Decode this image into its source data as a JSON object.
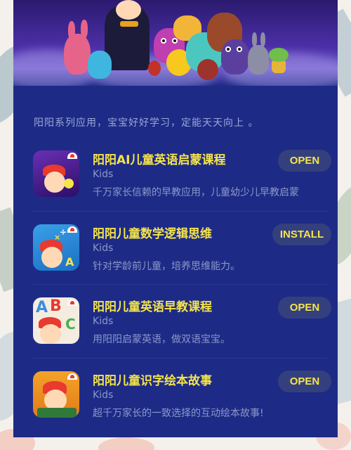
{
  "tagline": "阳阳系列应用，宝宝好好学习，定能天天向上 。",
  "apps": [
    {
      "title": "阳阳AI儿童英语启蒙课程",
      "category": "Kids",
      "description": "千万家长信赖的早教应用，儿童幼少儿早教启蒙",
      "action": "OPEN",
      "icon": "ai-english-app-icon"
    },
    {
      "title": "阳阳儿童数学逻辑思维",
      "category": "Kids",
      "description": "针对学龄前儿童，培养思维能力。",
      "action": "INSTALL",
      "icon": "math-logic-app-icon"
    },
    {
      "title": "阳阳儿童英语早教课程",
      "category": "Kids",
      "description": "用阳阳启蒙英语，做双语宝宝。",
      "action": "OPEN",
      "icon": "abc-english-app-icon"
    },
    {
      "title": "阳阳儿童识字绘本故事",
      "category": "Kids",
      "description": "超千万家长的一致选择的互动绘本故事!",
      "action": "OPEN",
      "icon": "picture-book-app-icon"
    }
  ],
  "colors": {
    "panel": "#1d2b86",
    "title": "#f5e44a",
    "secondary": "#8c97c9",
    "button_bg": "#34407e"
  }
}
